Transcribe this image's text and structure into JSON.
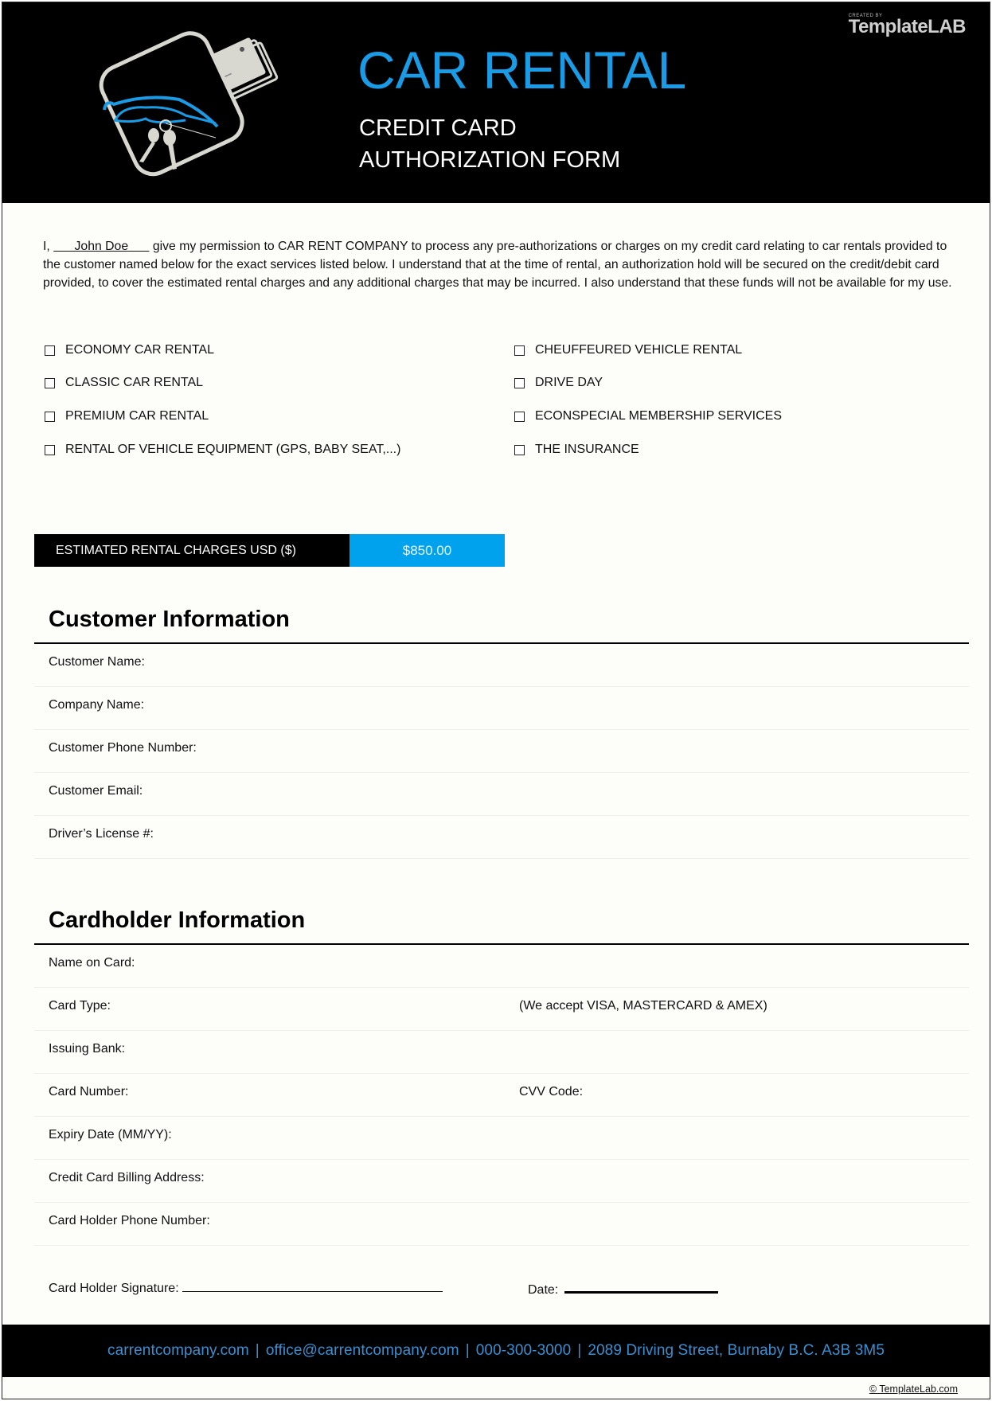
{
  "header": {
    "title": "CAR RENTAL",
    "subtitle_line1": "CREDIT CARD",
    "subtitle_line2": "AUTHORIZATION FORM",
    "brand_small": "CREATED BY",
    "brand_name": "TemplateLAB",
    "logo_icon": "car-keys-credit-card-icon"
  },
  "intro": {
    "prefix": "I, ",
    "name_value": "      John Doe      ",
    "body": " give my permission to CAR RENT COMPANY to process any pre-authorizations or charges on my credit card relating to car rentals provided to the customer named below for the exact services listed below. I understand that at the time of rental, an authorization hold will be secured on the credit/debit card provided, to cover the estimated rental charges and any additional charges that may be incurred. I also understand that these funds will not be available for my use."
  },
  "services": {
    "left": [
      {
        "label": "ECONOMY CAR RENTAL",
        "checked": false
      },
      {
        "label": "CLASSIC CAR RENTAL",
        "checked": false
      },
      {
        "label": "PREMIUM CAR RENTAL",
        "checked": false
      },
      {
        "label": "RENTAL OF VEHICLE EQUIPMENT (GPS, BABY SEAT,...)",
        "checked": false
      }
    ],
    "right": [
      {
        "label": "CHEUFFEURED VEHICLE RENTAL",
        "checked": false
      },
      {
        "label": "DRIVE DAY",
        "checked": false
      },
      {
        "label": "ECONSPECIAL MEMBERSHIP SERVICES",
        "checked": false
      },
      {
        "label": "THE INSURANCE",
        "checked": false
      }
    ]
  },
  "estimate": {
    "label": "ESTIMATED RENTAL CHARGES USD ($)",
    "value": "$850.00"
  },
  "customer": {
    "heading": "Customer Information",
    "fields": [
      {
        "label": "Customer Name:",
        "value": ""
      },
      {
        "label": "Company Name:",
        "value": ""
      },
      {
        "label": "Customer Phone Number:",
        "value": ""
      },
      {
        "label": "Customer Email:",
        "value": ""
      },
      {
        "label": "Driver’s License #:",
        "value": ""
      }
    ]
  },
  "cardholder": {
    "heading": "Cardholder Information",
    "fields": [
      {
        "label": "Name on Card:",
        "value": ""
      },
      {
        "label": "Card Type:",
        "value": "",
        "note": "(We accept VISA, MASTERCARD & AMEX)"
      },
      {
        "label": "Issuing Bank:",
        "value": ""
      },
      {
        "label": "Card Number:",
        "value": "",
        "second_label": "CVV Code:",
        "second_value": ""
      },
      {
        "label": "Expiry Date (MM/YY):",
        "value": ""
      },
      {
        "label": "Credit Card Billing Address:",
        "value": ""
      },
      {
        "label": "Card Holder Phone Number:",
        "value": ""
      }
    ],
    "signature_label": "Card Holder Signature:",
    "date_label": "Date:"
  },
  "footer": {
    "website": "carrentcompany.com",
    "email": "office@carrentcompany.com",
    "phone": "000-300-3000",
    "address": "2089 Driving Street, Burnaby B.C. A3B 3M5",
    "separator": "|"
  },
  "copyright": "© TemplateLab.com",
  "colors": {
    "accent_blue": "#1a9be6",
    "estimate_blue": "#00a2ee",
    "footer_text": "#3c8fd0",
    "header_bg": "#000000"
  }
}
